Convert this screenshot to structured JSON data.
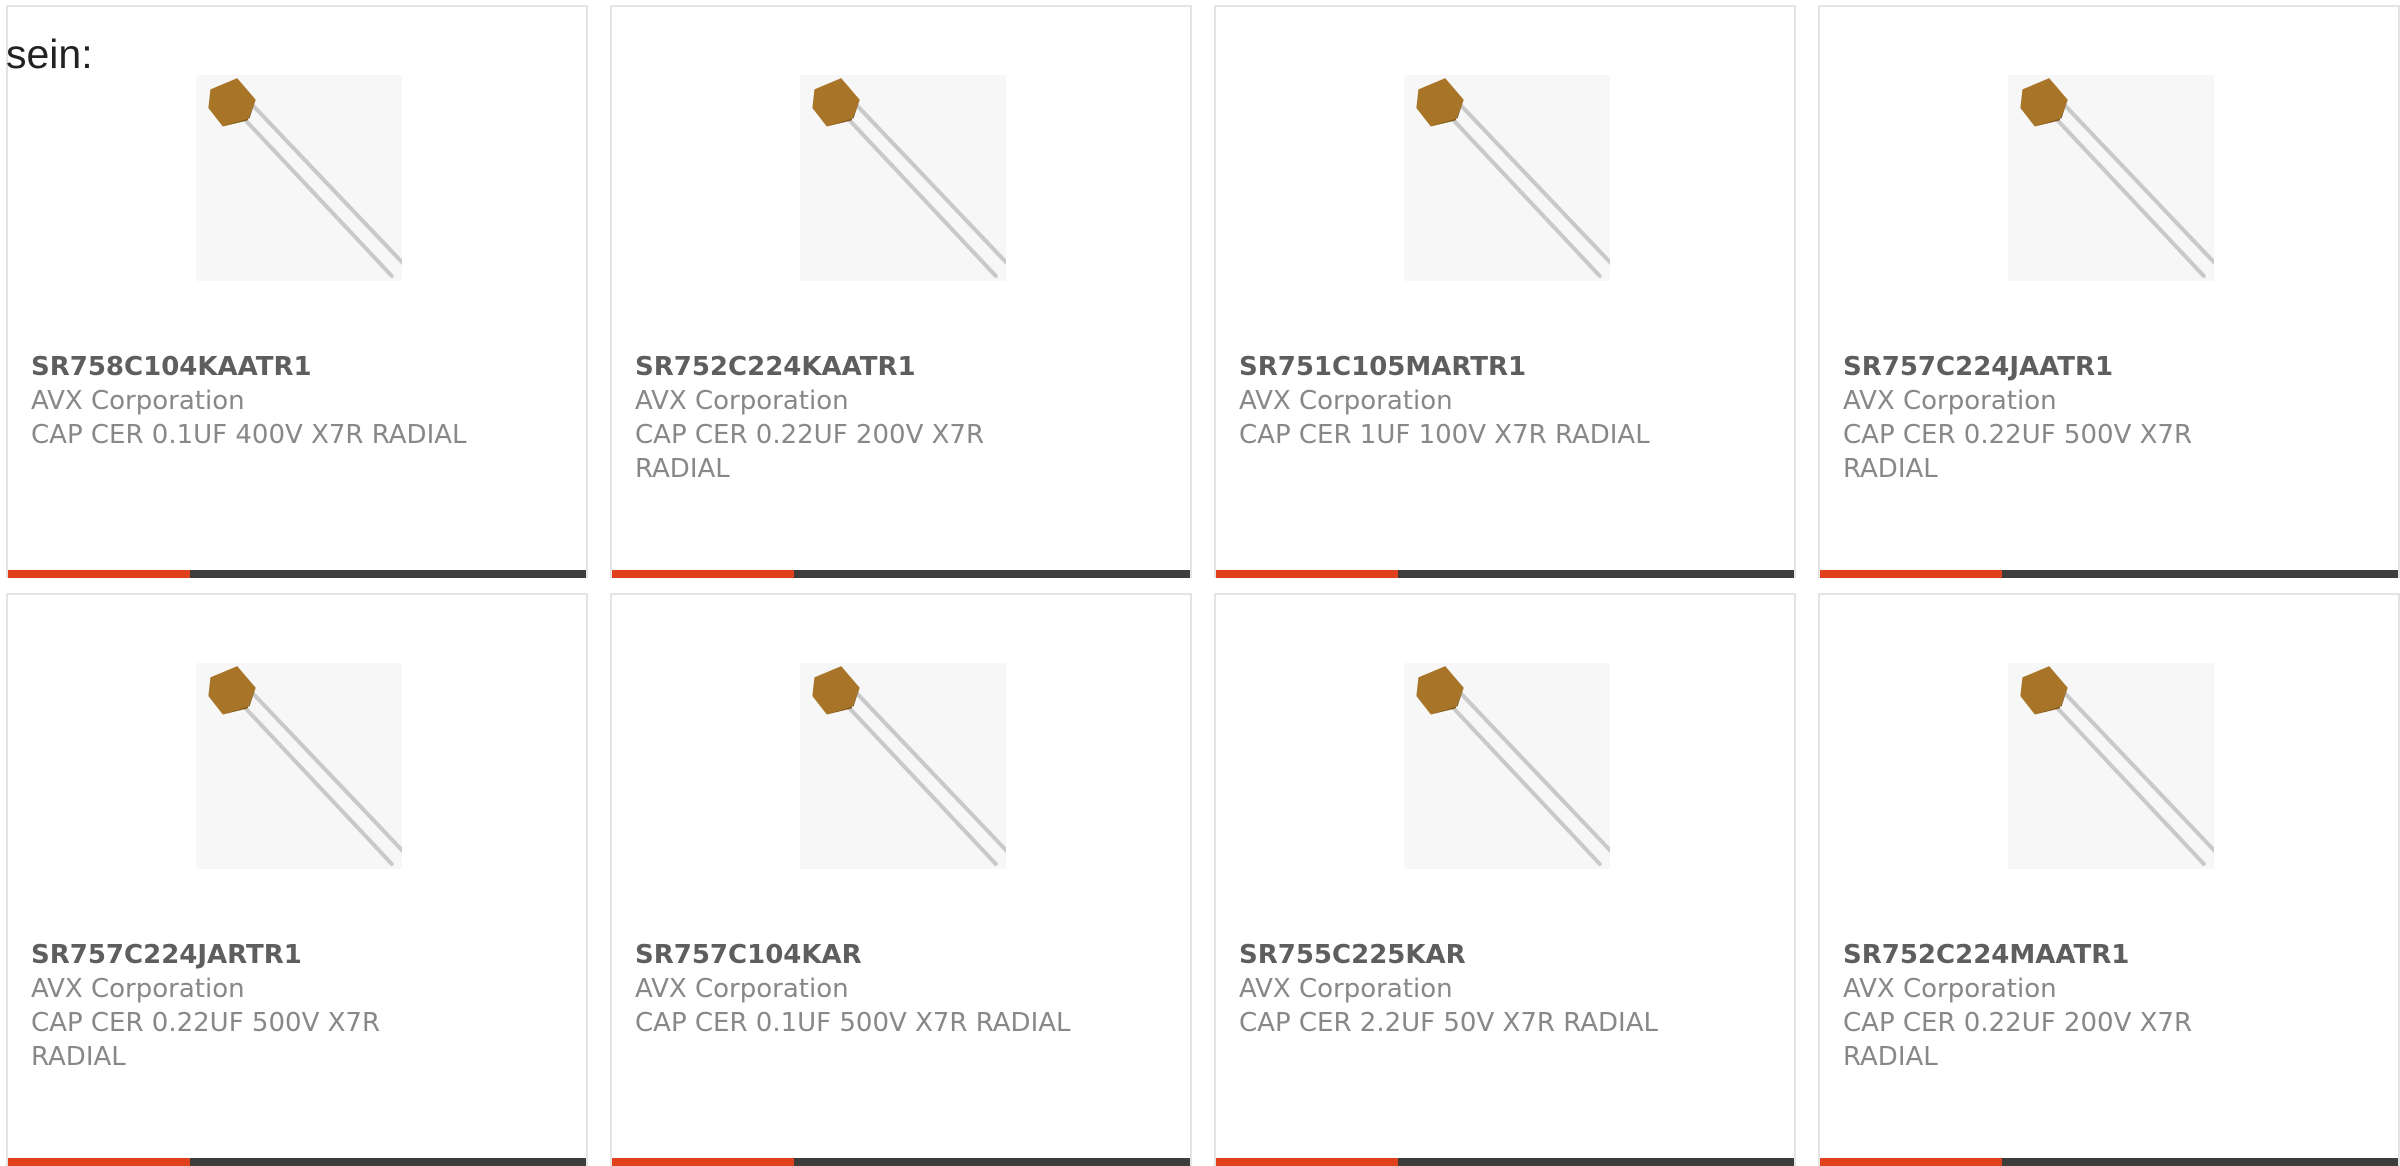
{
  "intro_text": "sein:",
  "colors": {
    "accent": "#e0411a",
    "bar": "#3d3d3d",
    "border": "#e4e4e4",
    "part_number": "#5e5e5e",
    "text": "#888888"
  },
  "product_image": "radial-ceramic-capacitor-icon",
  "products": [
    {
      "part_number": "SR758C104KAATR1",
      "manufacturer": "AVX Corporation",
      "description": "CAP CER 0.1UF 400V X7R RADIAL"
    },
    {
      "part_number": "SR752C224KAATR1",
      "manufacturer": "AVX Corporation",
      "description": "CAP CER 0.22UF 200V X7R RADIAL"
    },
    {
      "part_number": "SR751C105MARTR1",
      "manufacturer": "AVX Corporation",
      "description": "CAP CER 1UF 100V X7R RADIAL"
    },
    {
      "part_number": "SR757C224JAATR1",
      "manufacturer": "AVX Corporation",
      "description": "CAP CER 0.22UF 500V X7R RADIAL"
    },
    {
      "part_number": "SR757C224JARTR1",
      "manufacturer": "AVX Corporation",
      "description": "CAP CER 0.22UF 500V X7R RADIAL"
    },
    {
      "part_number": "SR757C104KAR",
      "manufacturer": "AVX Corporation",
      "description": "CAP CER 0.1UF 500V X7R RADIAL"
    },
    {
      "part_number": "SR755C225KAR",
      "manufacturer": "AVX Corporation",
      "description": "CAP CER 2.2UF 50V X7R RADIAL"
    },
    {
      "part_number": "SR752C224MAATR1",
      "manufacturer": "AVX Corporation",
      "description": "CAP CER 0.22UF 200V X7R RADIAL"
    }
  ]
}
